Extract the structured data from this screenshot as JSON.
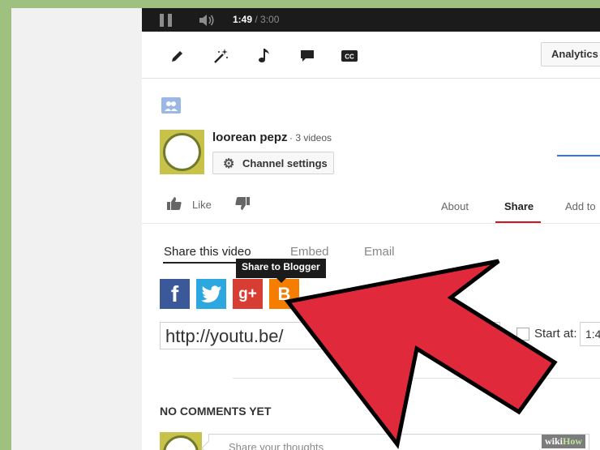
{
  "player": {
    "current_time": "1:49",
    "duration": "/ 3:00",
    "icons": [
      "pause-icon",
      "volume-icon"
    ]
  },
  "toolbar": {
    "tools": [
      {
        "name": "pencil-icon",
        "glyph": "✎"
      },
      {
        "name": "magic-wand-icon",
        "glyph": "⁂"
      },
      {
        "name": "music-note-icon",
        "glyph": "♪"
      },
      {
        "name": "annotations-icon",
        "glyph": "■"
      },
      {
        "name": "captions-icon",
        "glyph": "CC"
      }
    ],
    "analytics_label": "Analytics"
  },
  "channel": {
    "name": "loorean pepz",
    "video_count": "· 3 videos",
    "settings_label": "Channel settings"
  },
  "actions": {
    "like_label": "Like",
    "tabs": [
      "About",
      "Share",
      "Add to"
    ]
  },
  "share": {
    "tabs": [
      "Share this video",
      "Embed",
      "Email"
    ],
    "tooltip": "Share to Blogger",
    "networks": [
      {
        "name": "facebook",
        "glyph": "f",
        "color": "#3b5998"
      },
      {
        "name": "twitter",
        "glyph": "t",
        "color": "#2ca7e0"
      },
      {
        "name": "google-plus",
        "glyph": "g+",
        "color": "#d73d32"
      },
      {
        "name": "blogger",
        "glyph": "B",
        "color": "#f57d00"
      }
    ],
    "url": "http://youtu.be/",
    "start_at_label": "Start at:",
    "start_at_value": "1:4"
  },
  "comments": {
    "heading": "NO COMMENTS YET",
    "placeholder": "Share your thoughts"
  },
  "overlay": {
    "arrow_color": "#e02a3c",
    "watermark_wiki": "wiki",
    "watermark_how": "How"
  }
}
